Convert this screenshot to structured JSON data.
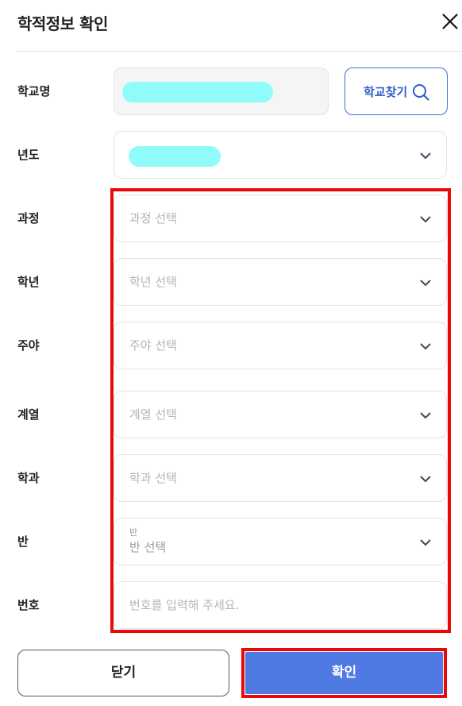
{
  "header": {
    "title": "학적정보 확인",
    "close_icon": "close-icon"
  },
  "fields": {
    "school": {
      "label": "학교명",
      "value_masked": true,
      "find_button_label": "학교찾기"
    },
    "year": {
      "label": "년도",
      "value_masked": true
    },
    "course": {
      "label": "과정",
      "placeholder": "과정 선택"
    },
    "grade": {
      "label": "학년",
      "placeholder": "학년 선택"
    },
    "daynight": {
      "label": "주야",
      "placeholder": "주야 선택"
    },
    "track": {
      "label": "계열",
      "placeholder": "계열 선택"
    },
    "department": {
      "label": "학과",
      "placeholder": "학과 선택"
    },
    "classroom": {
      "label": "반",
      "floating_label": "반",
      "placeholder": "반 선택"
    },
    "number": {
      "label": "번호",
      "placeholder": "번호를 입력해 주세요."
    }
  },
  "footer": {
    "close_label": "닫기",
    "confirm_label": "확인"
  },
  "colors": {
    "accent": "#4f7ae3",
    "find_button": "#2d5fc5",
    "highlight": "#e80a0a",
    "redaction": "#8ffcfa"
  }
}
